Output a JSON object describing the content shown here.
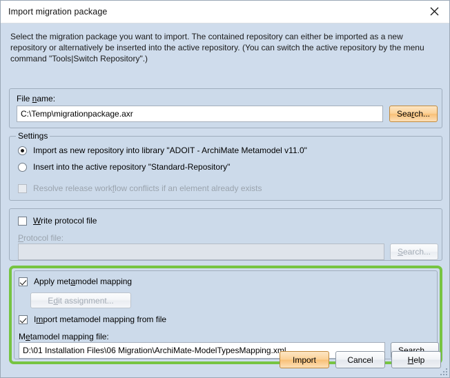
{
  "window": {
    "title": "Import migration package",
    "close_icon": "close-icon"
  },
  "intro": {
    "text": "Select the migration package you want to import. The contained repository can either be imported as a new repository or alternatively be inserted into the active repository. (You can switch the active repository by the menu command \"Tools|Switch Repository\".)"
  },
  "file_name_panel": {
    "label": "File name:",
    "label_mnemonic": "n",
    "value": "C:\\Temp\\migrationpackage.axr",
    "search_button": "Search...",
    "search_button_mnemonic": "c"
  },
  "settings_panel": {
    "legend": "Settings",
    "options": [
      {
        "label": "Import as new repository into library \"ADOIT - ArchiMate Metamodel v11.0\"",
        "selected": true
      },
      {
        "label": "Insert into the active repository \"Standard-Repository\"",
        "selected": false
      }
    ],
    "resolve_conflicts": {
      "label": "Resolve release workflow conflicts if an element already exists",
      "label_mnemonic": "f",
      "checked": false,
      "enabled": false
    }
  },
  "protocol_panel": {
    "write_protocol": {
      "label": "Write protocol file",
      "label_mnemonic": "W",
      "checked": false,
      "enabled": true
    },
    "protocol_file_label": "Protocol file:",
    "protocol_file_label_mnemonic": "P",
    "protocol_file_value": "",
    "search_button": "Search...",
    "search_button_mnemonic": "S",
    "search_enabled": false
  },
  "mapping_panel": {
    "highlight_color": "#76c442",
    "apply_mapping": {
      "label": "Apply metamodel mapping",
      "label_mnemonic": "a",
      "checked": true
    },
    "edit_assignment_button": "Edit assignment...",
    "edit_assignment_mnemonic": "d",
    "edit_assignment_enabled": false,
    "import_from_file": {
      "label": "Import metamodel mapping from file",
      "label_mnemonic": "m",
      "checked": true
    },
    "mapping_file_label": "Metamodel mapping file:",
    "mapping_file_label_mnemonic": "e",
    "mapping_file_value": "D:\\01 Installation Files\\06 Migration\\ArchiMate-ModelTypesMapping.xml",
    "search_button": "Search...",
    "search_button_mnemonic": "r"
  },
  "footer": {
    "import_button": "Import",
    "cancel_button": "Cancel",
    "help_button": "Help",
    "help_button_mnemonic": "H",
    "primary_color": "#f8c077"
  }
}
